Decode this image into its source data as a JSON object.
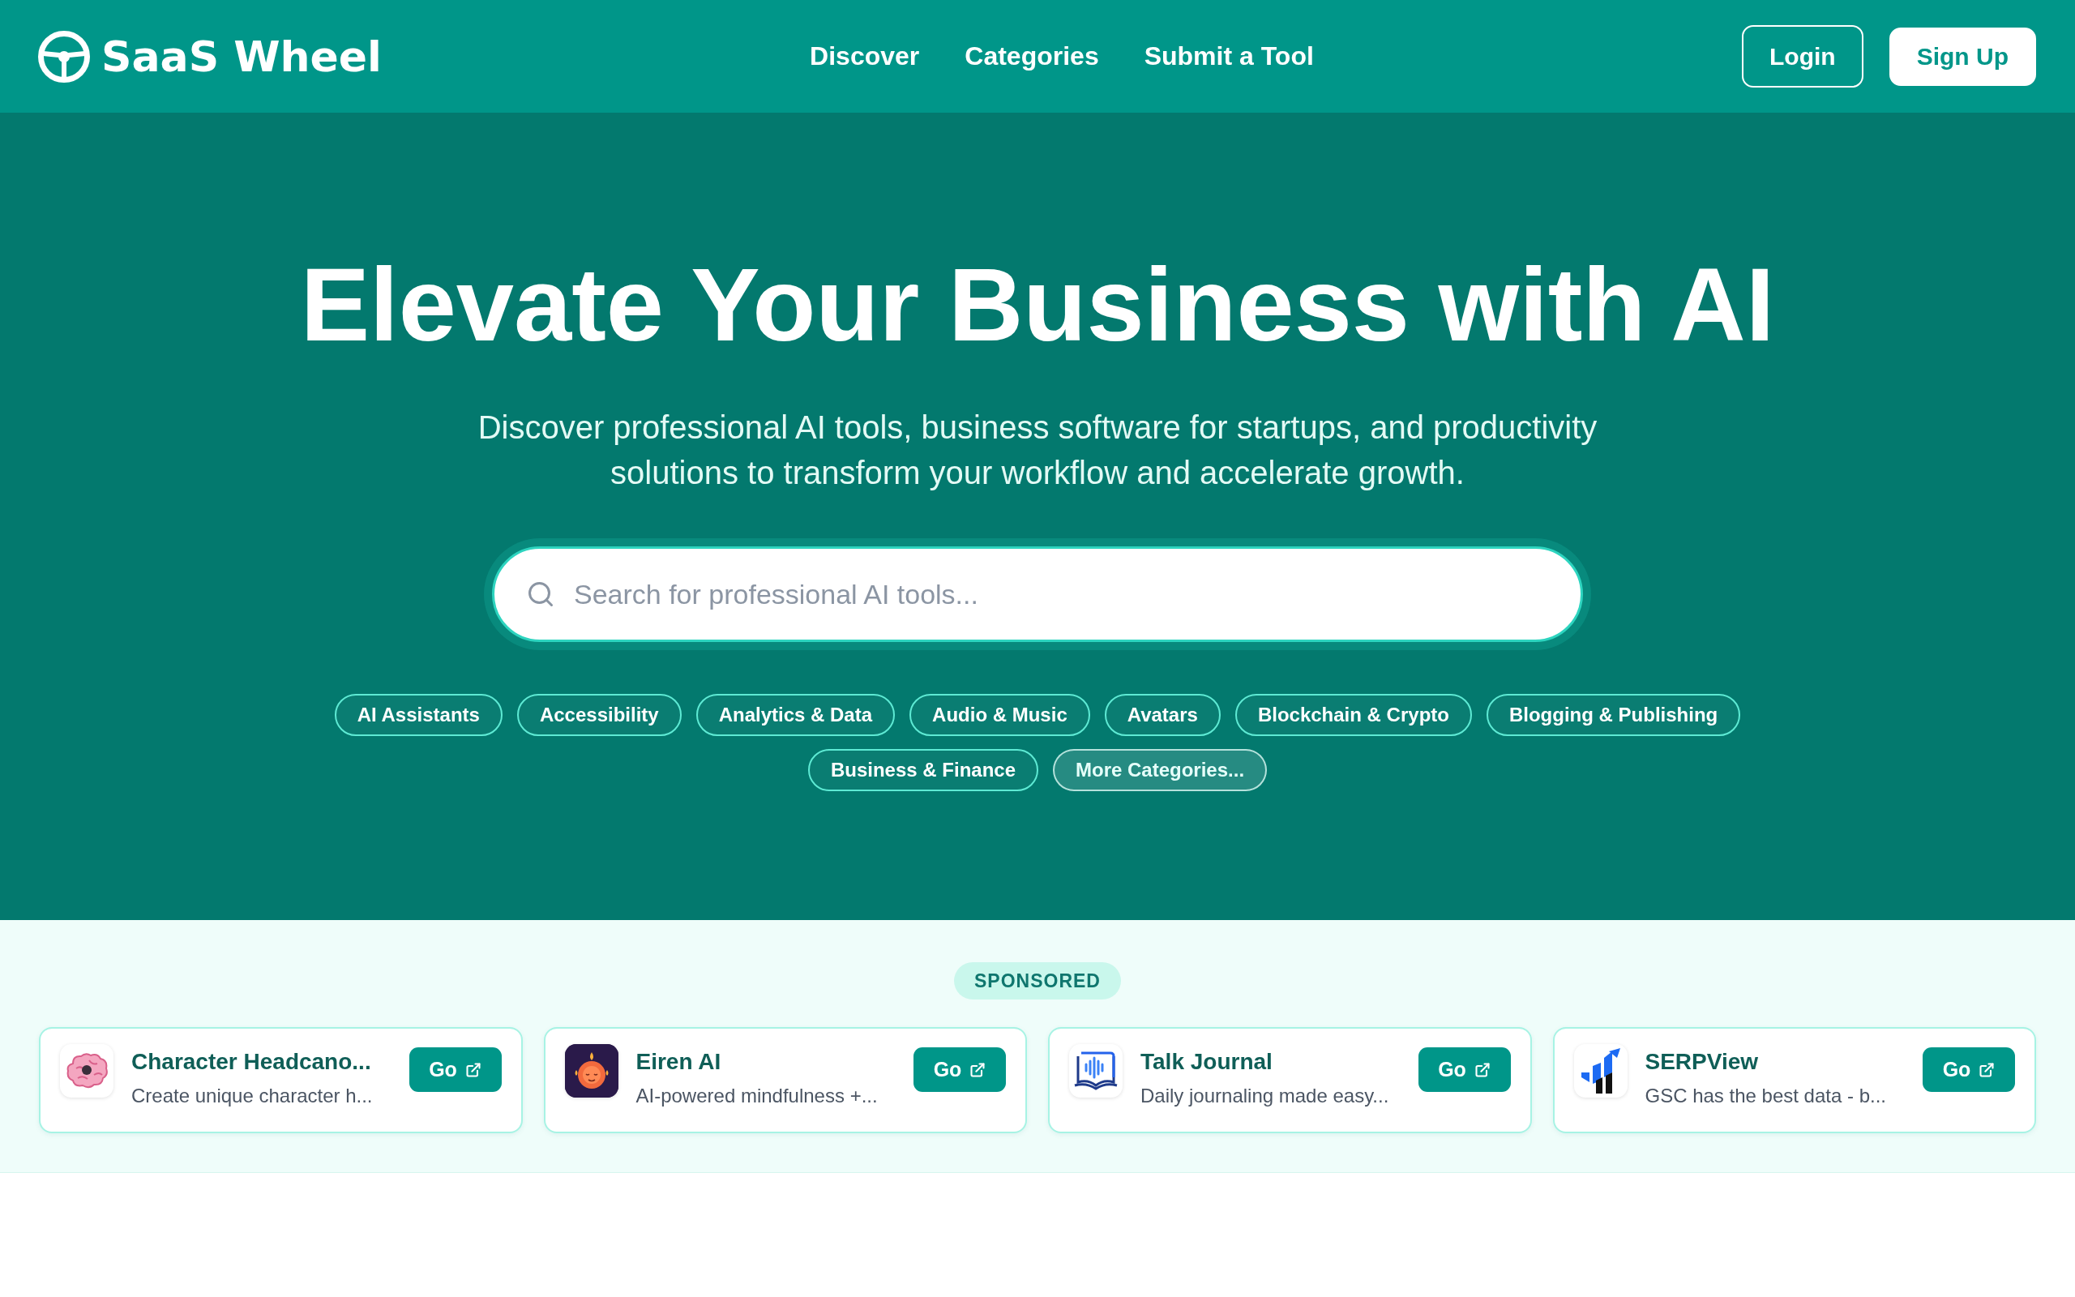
{
  "header": {
    "logo": "SaaS Wheel",
    "nav": [
      "Discover",
      "Categories",
      "Submit a Tool"
    ],
    "buttons": [
      {
        "label": "Login",
        "kind": "outline"
      },
      {
        "label": "Sign Up",
        "kind": "solid"
      }
    ]
  },
  "hero": {
    "title": "Elevate Your Business with AI",
    "subtitle": "Discover professional AI tools, business software for startups, and productivity solutions to transform your workflow and accelerate growth.",
    "search": {
      "placeholder": "Search for professional AI tools..."
    },
    "categories": [
      {
        "label": "AI Assistants",
        "kind": "category"
      },
      {
        "label": "Accessibility",
        "kind": "category"
      },
      {
        "label": "Analytics & Data",
        "kind": "category"
      },
      {
        "label": "Audio & Music",
        "kind": "category"
      },
      {
        "label": "Avatars",
        "kind": "category"
      },
      {
        "label": "Blockchain & Crypto",
        "kind": "category"
      },
      {
        "label": "Blogging & Publishing",
        "kind": "category"
      },
      {
        "label": "Business & Finance",
        "kind": "category"
      },
      {
        "label": "More Categories...",
        "kind": "more"
      }
    ]
  },
  "sponsored": {
    "badge": "SPONSORED",
    "tools": [
      {
        "name": "Character Headcano...",
        "description": "Create unique character h...",
        "button": "Go"
      },
      {
        "name": "Eiren AI",
        "description": "AI-powered mindfulness +...",
        "button": "Go"
      },
      {
        "name": "Talk Journal",
        "description": "Daily journaling made easy...",
        "button": "Go"
      },
      {
        "name": "SERPView",
        "description": "GSC has the best data - b...",
        "button": "Go"
      }
    ]
  }
}
